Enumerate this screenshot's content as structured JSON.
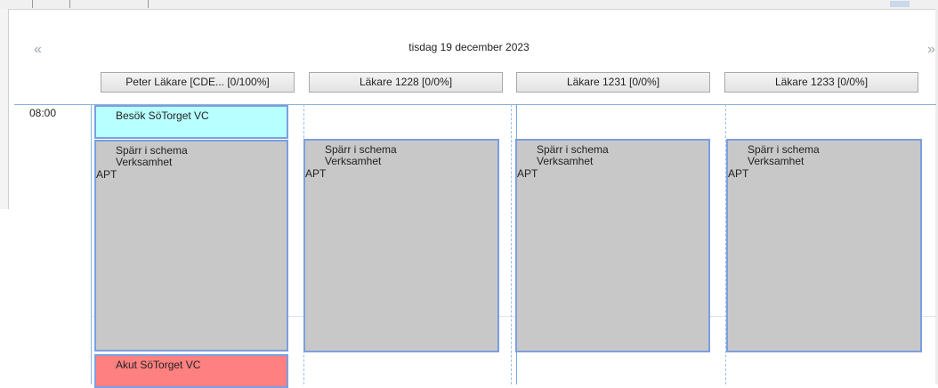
{
  "nav": {
    "prev_glyph": "«",
    "next_glyph": "»"
  },
  "date_title": "tisdag 19 december 2023",
  "columns": [
    {
      "label": "Peter Läkare [CDE...  [0/100%]"
    },
    {
      "label": "Läkare 1228  [0/0%]"
    },
    {
      "label": "Läkare 1231  [0/0%]"
    },
    {
      "label": "Läkare 1233  [0/0%]"
    }
  ],
  "time_slots": [
    "08:00"
  ],
  "appointments": {
    "col0_visit": {
      "title": "Besök SöTorget VC",
      "color": "#b8ffff"
    },
    "col0_block": {
      "line1": "Spärr i schema",
      "line2": "Verksamhet",
      "line3": "APT",
      "color": "#c8c8c8"
    },
    "col0_acute": {
      "title": "Akut SöTorget VC",
      "color": "#ff8080"
    },
    "col1_block": {
      "line1": "Spärr i schema",
      "line2": "Verksamhet",
      "line3": "APT",
      "color": "#c8c8c8"
    },
    "col2_block": {
      "line1": "Spärr i schema",
      "line2": "Verksamhet",
      "line3": "APT",
      "color": "#c8c8c8"
    },
    "col3_block": {
      "line1": "Spärr i schema",
      "line2": "Verksamhet",
      "line3": "APT",
      "color": "#c8c8c8"
    }
  },
  "colors": {
    "border_accent": "#7b9fe0",
    "grid_line": "#8fb3d9"
  }
}
